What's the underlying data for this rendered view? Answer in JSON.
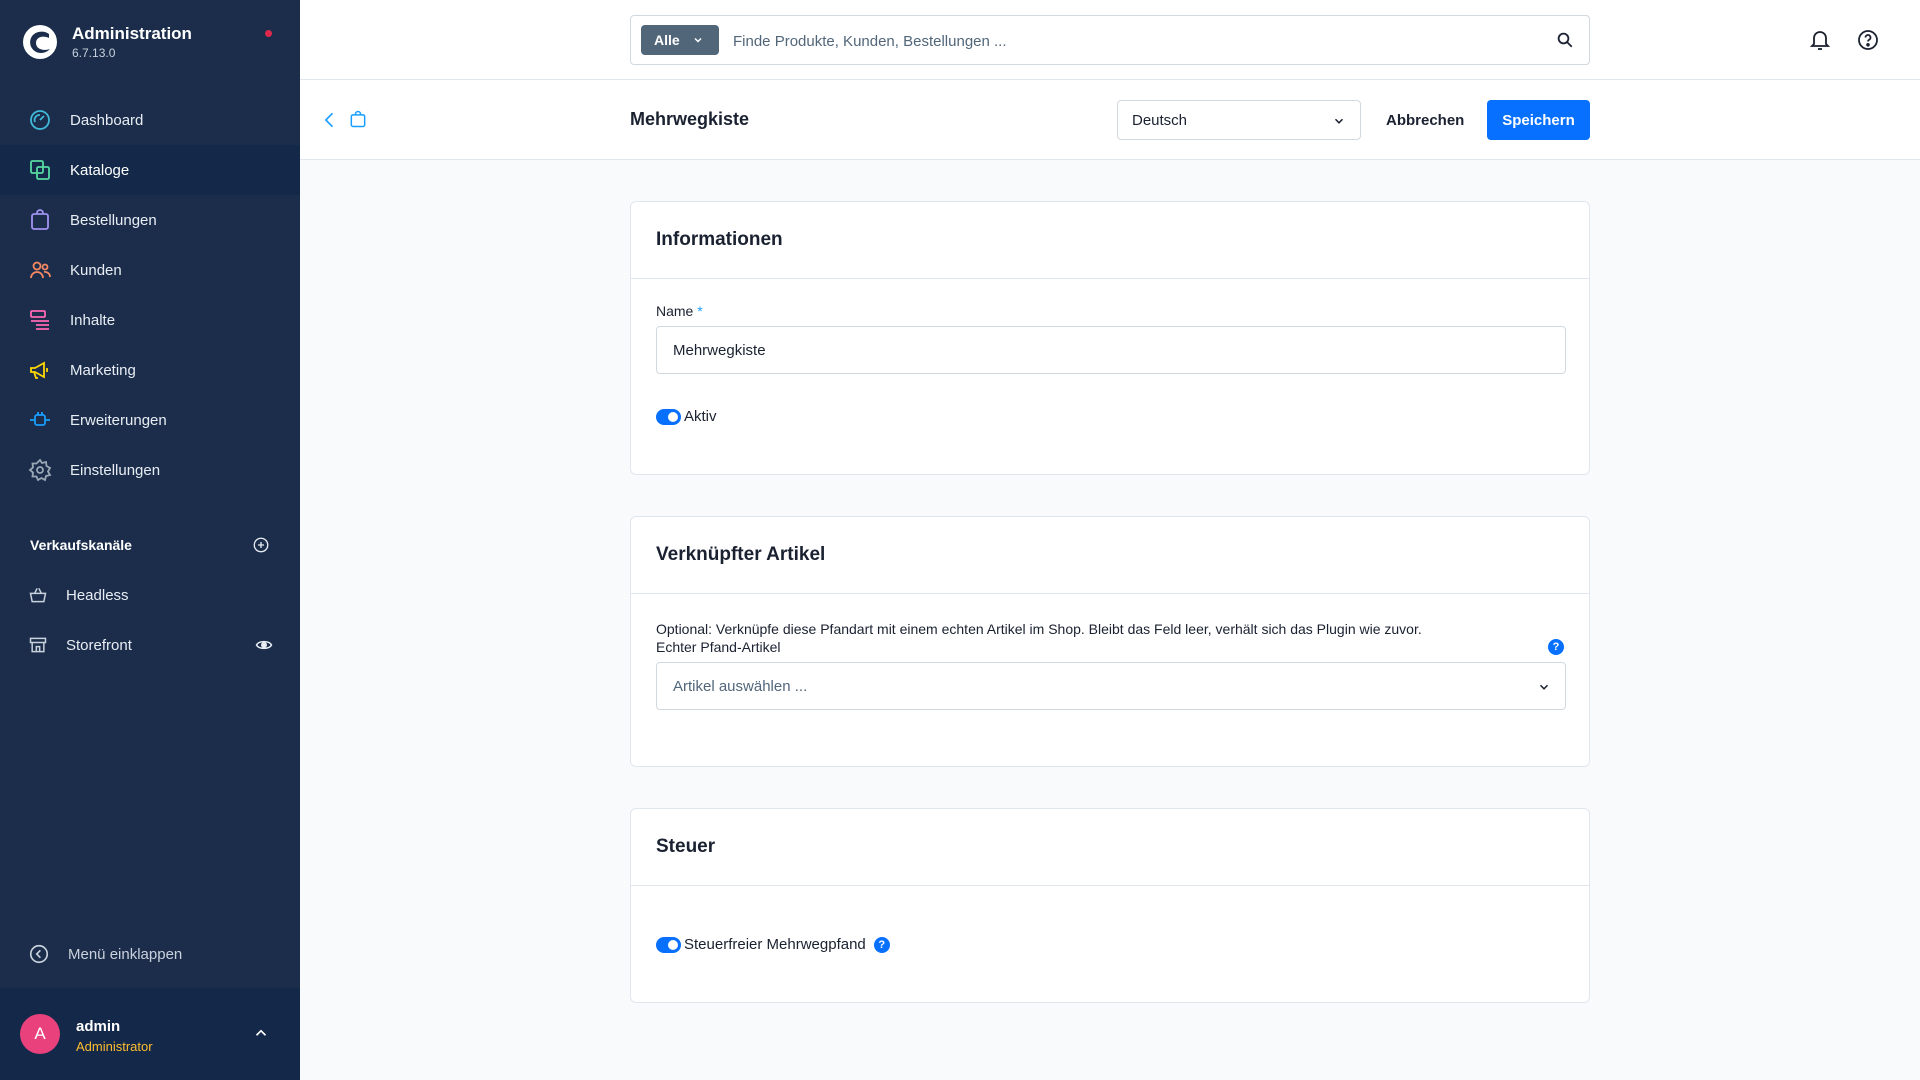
{
  "app": {
    "title": "Administration",
    "version": "6.7.13.0"
  },
  "nav": [
    {
      "id": "dashboard",
      "label": "Dashboard",
      "icon": "dashboard-icon",
      "color": "#3fbad6"
    },
    {
      "id": "catalogues",
      "label": "Kataloge",
      "icon": "products-icon",
      "color": "#57d9a3"
    },
    {
      "id": "orders",
      "label": "Bestellungen",
      "icon": "shopping-bag-icon",
      "color": "#a092f0"
    },
    {
      "id": "customers",
      "label": "Kunden",
      "icon": "users-icon",
      "color": "#f88962"
    },
    {
      "id": "content",
      "label": "Inhalte",
      "icon": "content-icon",
      "color": "#ff68b4"
    },
    {
      "id": "marketing",
      "label": "Marketing",
      "icon": "megaphone-icon",
      "color": "#ffd700"
    },
    {
      "id": "extensions",
      "label": "Erweiterungen",
      "icon": "plug-icon",
      "color": "#189eff"
    },
    {
      "id": "settings",
      "label": "Einstellungen",
      "icon": "gear-icon",
      "color": "#9aa8b5"
    }
  ],
  "active_nav": "catalogues",
  "sales_channels": {
    "title": "Verkaufskanäle",
    "items": [
      {
        "label": "Headless"
      },
      {
        "label": "Storefront"
      }
    ]
  },
  "collapse_label": "Menü einklappen",
  "user": {
    "initial": "A",
    "name": "admin",
    "role": "Administrator"
  },
  "search": {
    "scope": "Alle",
    "placeholder": "Finde Produkte, Kunden, Bestellungen ..."
  },
  "smartbar": {
    "title": "Mehrwegkiste",
    "language": "Deutsch",
    "cancel_label": "Abbrechen",
    "save_label": "Speichern"
  },
  "card_info": {
    "title": "Informationen",
    "name_label": "Name",
    "required_mark": "*",
    "name_value": "Mehrwegkiste",
    "active_label": "Aktiv",
    "active": true
  },
  "card_linked": {
    "title": "Verknüpfter Artikel",
    "help_text": "Optional: Verknüpfe diese Pfandart mit einem echten Artikel im Shop. Bleibt das Feld leer, verhält sich das Plugin wie zuvor.",
    "field_label": "Echter Pfand-Artikel",
    "placeholder": "Artikel auswählen ..."
  },
  "card_tax": {
    "title": "Steuer",
    "toggle_label": "Steuerfreier Mehrwegpfand",
    "enabled": true
  },
  "colors": {
    "sidebar": "#1b2d4b",
    "primary": "#0870ff",
    "avatar": "#e8417c",
    "role": "#ffbd2f",
    "notification": "#de294c"
  }
}
